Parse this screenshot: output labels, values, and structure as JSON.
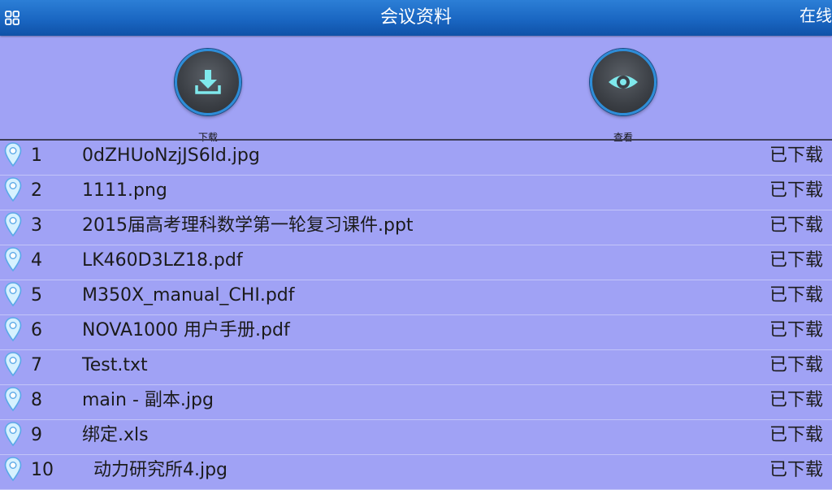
{
  "header": {
    "title": "会议资料",
    "status": "在线"
  },
  "toolbar": {
    "download_label": "下载",
    "view_label": "查看"
  },
  "colors": {
    "header_blue": "#1a66c2",
    "background": "#a0a2f5",
    "ring_blue": "#2d8dd8",
    "icon_cyan": "#7fe8ec"
  },
  "files": [
    {
      "index": "1",
      "name": "0dZHUoNzjJS6ld.jpg",
      "status": "已下载"
    },
    {
      "index": "2",
      "name": "1111.png",
      "status": "已下载"
    },
    {
      "index": "3",
      "name": "2015届高考理科数学第一轮复习课件.ppt",
      "status": "已下载"
    },
    {
      "index": "4",
      "name": "LK460D3LZ18.pdf",
      "status": "已下载"
    },
    {
      "index": "5",
      "name": "M350X_manual_CHI.pdf",
      "status": "已下载"
    },
    {
      "index": "6",
      "name": "NOVA1000 用户手册.pdf",
      "status": "已下载"
    },
    {
      "index": "7",
      "name": "Test.txt",
      "status": "已下载"
    },
    {
      "index": "8",
      "name": "main - 副本.jpg",
      "status": "已下载"
    },
    {
      "index": "9",
      "name": "绑定.xls",
      "status": "已下载"
    },
    {
      "index": "10",
      "name": "  动力研究所4.jpg",
      "status": "已下载"
    }
  ]
}
